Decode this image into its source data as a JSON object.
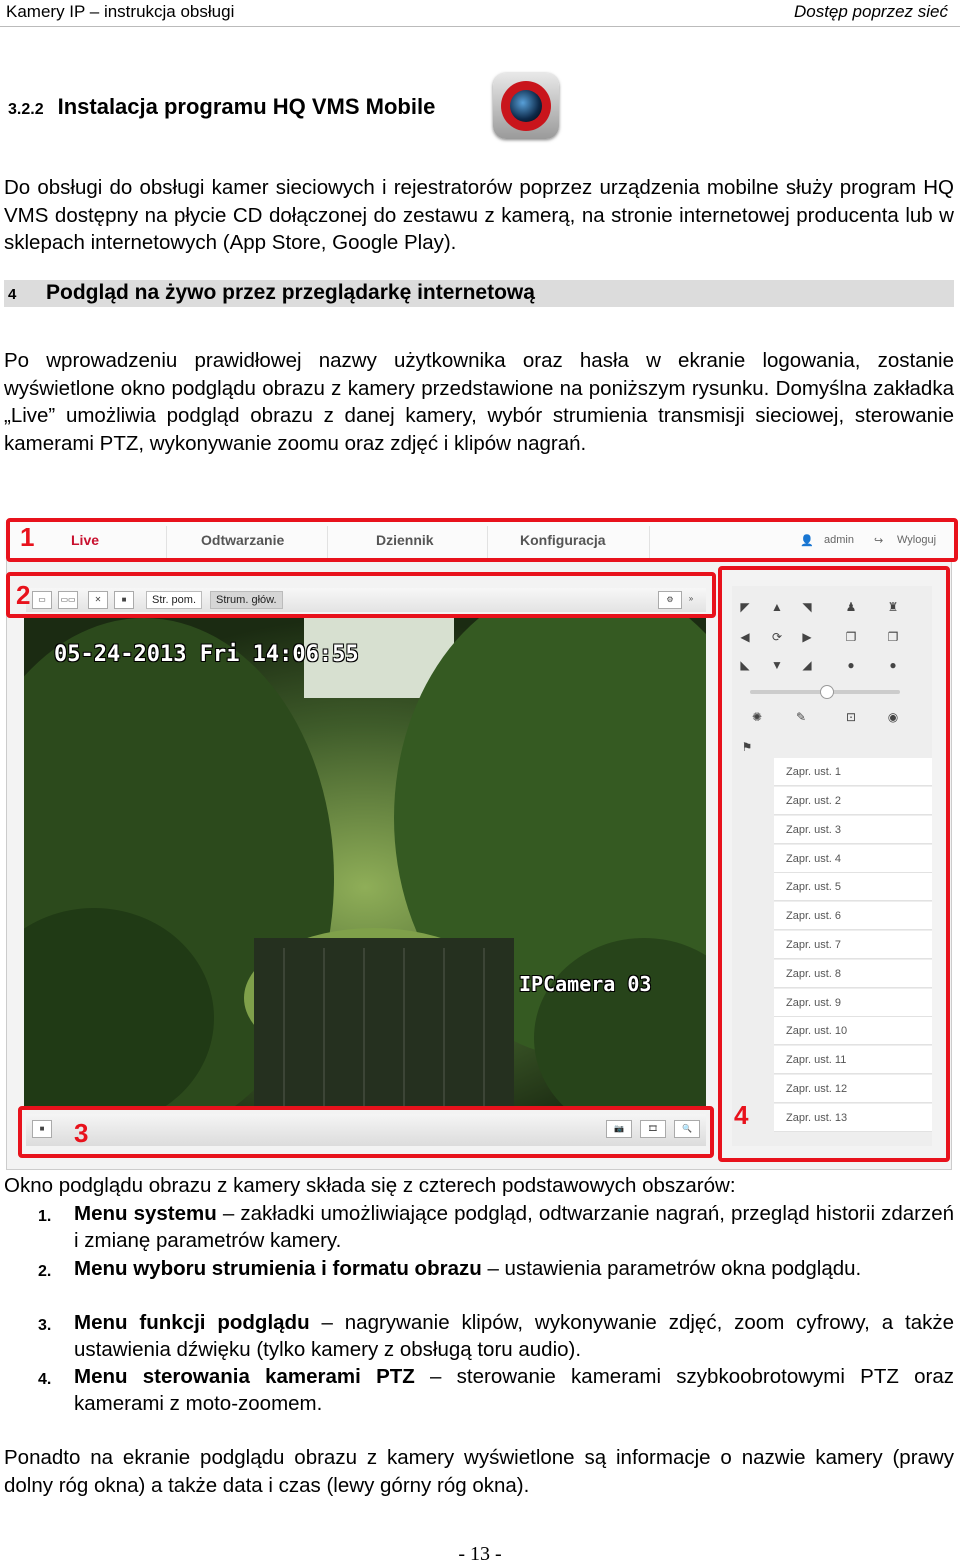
{
  "header": {
    "left": "Kamery IP – instrukcja obsługi",
    "right": "Dostęp poprzez sieć"
  },
  "section": {
    "number": "3.2.2",
    "title": "Instalacja programu HQ VMS Mobile"
  },
  "intro": "Do obsługi do obsługi kamer sieciowych i rejestratorów poprzez urządzenia mobilne służy program HQ VMS dostępny na płycie CD dołączonej do zestawu z kamerą, na stronie internetowej producenta lub w sklepach internetowych (App Store, Google Play).",
  "chapter": {
    "number": "4",
    "title": "Podgląd na żywo przez przeglądarkę internetową"
  },
  "para1": "Po wprowadzeniu prawidłowej nazwy użytkownika oraz hasła w ekranie logowania, zostanie wyświetlone okno podglądu obrazu z kamery przedstawione na poniższym rysunku. Domyślna zakładka „Live” umożliwia podgląd obrazu z danej kamery, wybór strumienia transmisji sieciowej, sterowanie kamerami PTZ, wykonywanie zoomu oraz zdjęć i klipów nagrań.",
  "ui": {
    "labels": [
      "1",
      "2",
      "3",
      "4"
    ],
    "tabs": [
      "Live",
      "Odtwarzanie",
      "Dziennik",
      "Konfiguracja"
    ],
    "user": "admin",
    "logout": "Wyloguj",
    "stream_sub": "Str. pom.",
    "stream_main": "Strum. głów.",
    "osd_time": "05-24-2013 Fri 14:06:55",
    "osd_name": "IPCamera 03",
    "presets": [
      "Zapr. ust. 1",
      "Zapr. ust. 2",
      "Zapr. ust. 3",
      "Zapr. ust. 4",
      "Zapr. ust. 5",
      "Zapr. ust. 6",
      "Zapr. ust. 7",
      "Zapr. ust. 8",
      "Zapr. ust. 9",
      "Zapr. ust. 10",
      "Zapr. ust. 11",
      "Zapr. ust. 12",
      "Zapr. ust. 13"
    ],
    "accent": "#e8121c"
  },
  "list_intro": "Okno podglądu obrazu z kamery składa się z czterech podstawowych obszarów:",
  "items": [
    {
      "n": "1.",
      "bold": "Menu systemu",
      "text": " – zakładki umożliwiające podgląd, odtwarzanie nagrań, przegląd historii zdarzeń i zmianę parametrów kamery."
    },
    {
      "n": "2.",
      "bold": "Menu wyboru strumienia i formatu obrazu",
      "text": " – ustawienia parametrów okna podglądu."
    },
    {
      "n": "3.",
      "bold": "Menu funkcji podglądu",
      "text": " – nagrywanie klipów, wykonywanie zdjęć, zoom cyfrowy, a także ustawienia dźwięku (tylko kamery z obsługą toru audio)."
    },
    {
      "n": "4.",
      "bold": "Menu sterowania kamerami PTZ",
      "text": " – sterowanie kamerami szybkoobrotowymi PTZ oraz kamerami z moto-zoomem."
    }
  ],
  "outro": "Ponadto na ekranie podglądu obrazu z kamery wyświetlone są informacje o nazwie kamery (prawy dolny róg okna) a także data i czas (lewy górny róg okna).",
  "page_number": "- 13 -"
}
